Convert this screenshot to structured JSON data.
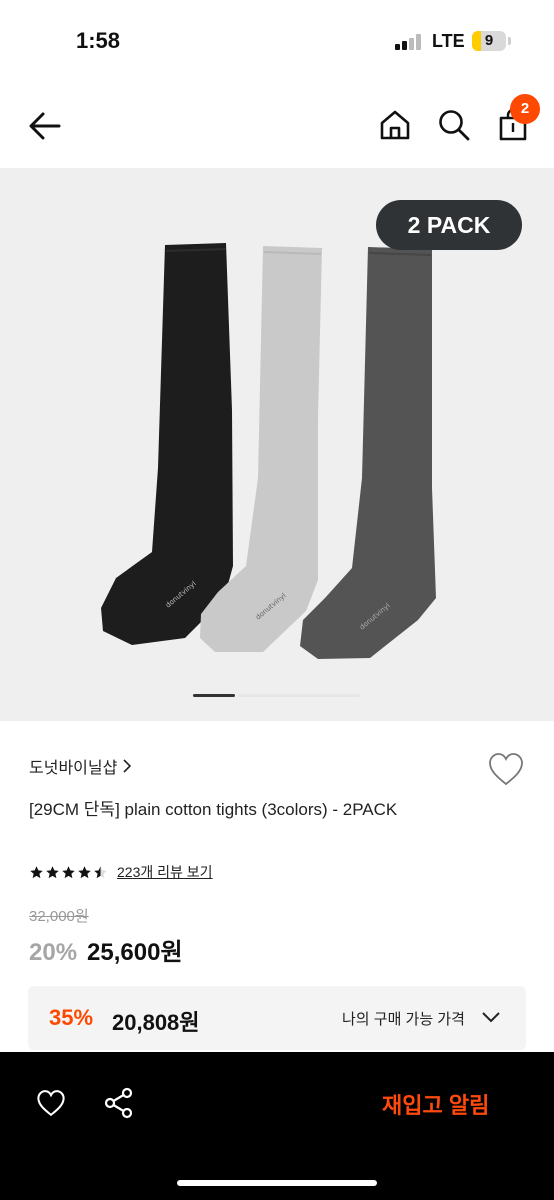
{
  "status": {
    "time": "1:58",
    "network": "LTE",
    "battery": "9"
  },
  "header": {
    "back_icon": "arrow-left-icon",
    "home_icon": "home-icon",
    "search_icon": "search-icon",
    "cart_icon": "shopping-bag-icon",
    "cart_count": "2"
  },
  "gallery": {
    "badge": "2 PACK",
    "image_description": "three knee-high socks: black, light gray, charcoal gray",
    "current_page": 1
  },
  "product": {
    "brand": "도넛바이닐샵",
    "brand_chevron": ">",
    "title": "[29CM 단독] plain cotton tights (3colors) - 2PACK",
    "rating_value": 4.5,
    "review_link": "223개 리뷰 보기",
    "original_price": "32,000원",
    "discount_pct": "20%",
    "sale_price": "25,600원"
  },
  "my_price": {
    "discount_pct": "35%",
    "price": "20,808원",
    "label": "나의 구매 가능 가격"
  },
  "bottom_bar": {
    "wishlist_icon": "heart-icon",
    "share_icon": "share-icon",
    "restock_label": "재입고 알림"
  },
  "colors": {
    "accent": "#ff4800",
    "restock_text": "#ff4a0d",
    "badge_bg": "#2f3336",
    "gallery_bg": "#efefef",
    "bottom_bg": "#000000"
  }
}
